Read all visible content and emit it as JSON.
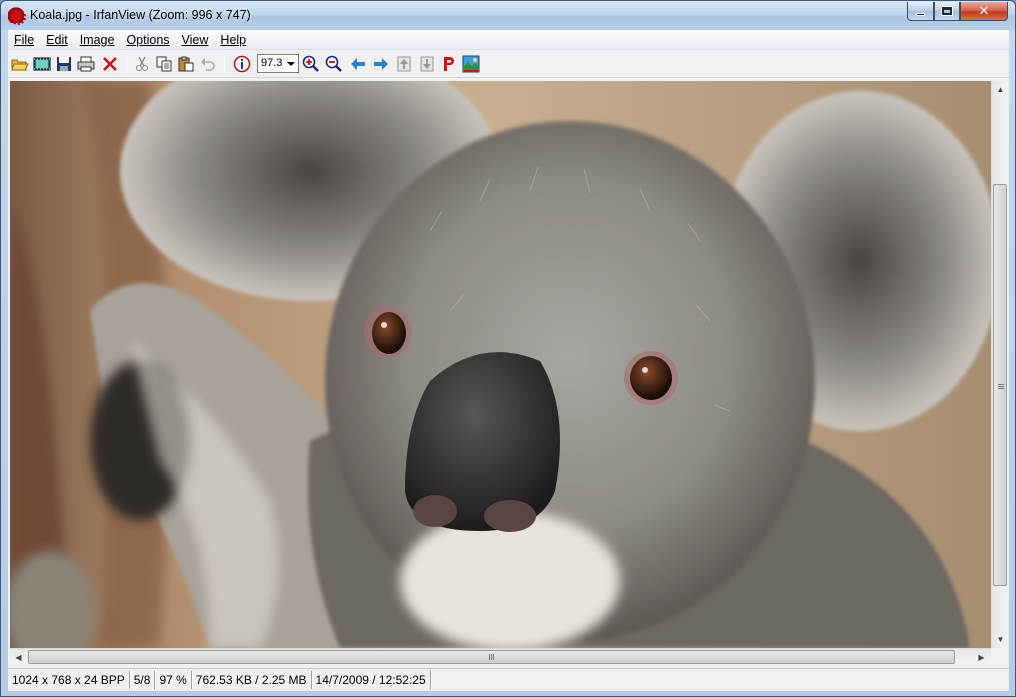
{
  "window": {
    "title": "Koala.jpg - IrfanView (Zoom: 996 x 747)",
    "app_icon": "irfanview-cat-icon"
  },
  "menu": [
    {
      "label": "File",
      "hotkey_index": 0
    },
    {
      "label": "Edit",
      "hotkey_index": 0
    },
    {
      "label": "Image",
      "hotkey_index": 0
    },
    {
      "label": "Options",
      "hotkey_index": 0
    },
    {
      "label": "View",
      "hotkey_index": 0
    },
    {
      "label": "Help",
      "hotkey_index": 0
    }
  ],
  "toolbar": {
    "icons": [
      "open-folder-icon",
      "slideshow-icon",
      "save-icon",
      "print-icon",
      "delete-icon",
      "cut-icon",
      "copy-icon",
      "paste-icon",
      "undo-icon",
      "info-icon",
      "zoom-in-icon",
      "zoom-out-icon",
      "previous-icon",
      "next-icon",
      "first-icon",
      "last-icon",
      "paint-icon",
      "thumbnails-icon"
    ],
    "zoom_value": "97.3"
  },
  "status": {
    "dimensions": "1024 x 768 x 24 BPP",
    "index": "5/8",
    "zoom": "97 %",
    "file_size": "762.53 KB / 2.25 MB",
    "datetime": "14/7/2009 / 12:52:25"
  },
  "colors": {
    "titlebar": "#bcd3ec",
    "close_button": "#c13b1e",
    "arrow_blue": "#2a7fd6"
  }
}
